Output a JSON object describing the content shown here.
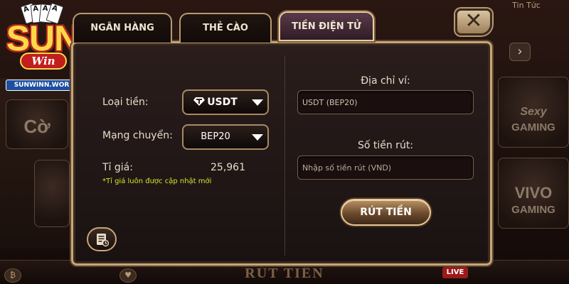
{
  "logo": {
    "brand": "SUN",
    "sub": "Win",
    "domain": "SUNWINN.WORK",
    "cards": [
      "A",
      "A",
      "A",
      "A"
    ]
  },
  "background": {
    "top_right_label": "Tin Tức",
    "bottom_title": "RÚT TIỀN",
    "live_badge": "LIVE",
    "tiles": [
      "Sexy",
      "GAMING",
      "VIVO",
      "GAMING",
      "Cờ"
    ]
  },
  "tabs": [
    {
      "label": "NGÂN HÀNG",
      "active": false
    },
    {
      "label": "THẺ CÀO",
      "active": false
    },
    {
      "label": "TIỀN ĐIỆN TỬ",
      "active": true
    }
  ],
  "close_symbol": "✕",
  "form": {
    "coin_label": "Loại tiền:",
    "coin_value": "USDT",
    "network_label": "Mạng chuyển:",
    "network_value": "BEP20",
    "rate_label": "Tỉ giá:",
    "rate_value": "25,961",
    "rate_note": "*Tỉ giá luôn được cập nhật mới",
    "wallet_title": "Địa chỉ ví:",
    "wallet_value": "USDT (BEP20)",
    "amount_title": "Số tiền rút:",
    "amount_placeholder": "Nhập số tiền rút (VND)",
    "submit_label": "RÚT TIỀN"
  },
  "colors": {
    "accent_gold": "#c7a678",
    "note_yellow": "#d7e32a",
    "active_tab": "#5a3a4a"
  },
  "icons": {
    "coin": "tether-icon",
    "history": "history-list-icon",
    "close": "close-icon",
    "dropdown": "caret-down-icon"
  }
}
